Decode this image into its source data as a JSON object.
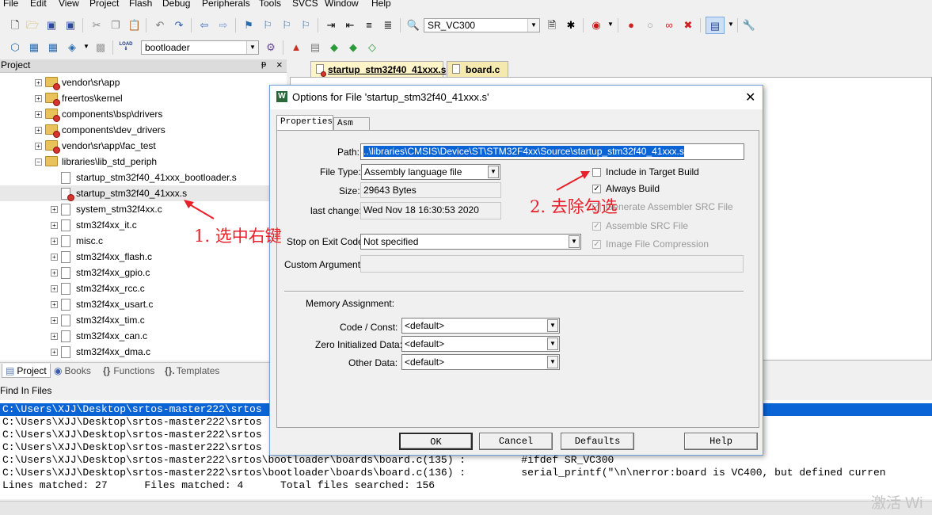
{
  "menu": [
    "File",
    "Edit",
    "View",
    "Project",
    "Flash",
    "Debug",
    "Peripherals",
    "Tools",
    "SVCS",
    "Window",
    "Help"
  ],
  "toolbar1": {
    "target_combo": "SR_VC300"
  },
  "toolbar2": {
    "target_name": "bootloader",
    "load_label": "LOAD"
  },
  "project_panel": {
    "title": "Project",
    "pin": "ᵽ",
    "close": "×",
    "tree": [
      {
        "label": "vendor\\sr\\app",
        "type": "group",
        "expand": "+"
      },
      {
        "label": "freertos\\kernel",
        "type": "group",
        "expand": "+"
      },
      {
        "label": "components\\bsp\\drivers",
        "type": "group",
        "expand": "+"
      },
      {
        "label": "components\\dev_drivers",
        "type": "group",
        "expand": "+"
      },
      {
        "label": "vendor\\sr\\app\\fac_test",
        "type": "group",
        "expand": "+"
      },
      {
        "label": "libraries\\lib_std_periph",
        "type": "open-folder",
        "expand": "−"
      },
      {
        "label": "startup_stm32f40_41xxx_bootloader.s",
        "type": "file",
        "expand": ""
      },
      {
        "label": "startup_stm32f40_41xxx.s",
        "type": "file-selected",
        "expand": ""
      },
      {
        "label": "system_stm32f4xx.c",
        "type": "file",
        "expand": "+"
      },
      {
        "label": "stm32f4xx_it.c",
        "type": "file",
        "expand": "+"
      },
      {
        "label": "misc.c",
        "type": "file",
        "expand": "+"
      },
      {
        "label": "stm32f4xx_flash.c",
        "type": "file",
        "expand": "+"
      },
      {
        "label": "stm32f4xx_gpio.c",
        "type": "file",
        "expand": "+"
      },
      {
        "label": "stm32f4xx_rcc.c",
        "type": "file",
        "expand": "+"
      },
      {
        "label": "stm32f4xx_usart.c",
        "type": "file",
        "expand": "+"
      },
      {
        "label": "stm32f4xx_tim.c",
        "type": "file",
        "expand": "+"
      },
      {
        "label": "stm32f4xx_can.c",
        "type": "file",
        "expand": "+"
      },
      {
        "label": "stm32f4xx_dma.c",
        "type": "file",
        "expand": "+"
      }
    ],
    "tabs": [
      "Project",
      "Books",
      "Functions",
      "Templates"
    ]
  },
  "editor": {
    "tabs": [
      "startup_stm32f40_41xxx.s",
      "board.c"
    ]
  },
  "find_in_files": {
    "title": "Find In Files",
    "lines": [
      "C:\\Users\\XJJ\\Desktop\\srtos-master222\\srtos",
      "C:\\Users\\XJJ\\Desktop\\srtos-master222\\srtos",
      "C:\\Users\\XJJ\\Desktop\\srtos-master222\\srtos",
      "C:\\Users\\XJJ\\Desktop\\srtos-master222\\srtos",
      "C:\\Users\\XJJ\\Desktop\\srtos-master222\\srtos\\bootloader\\boards\\board.c(135) :         #ifdef SR_VC300",
      "C:\\Users\\XJJ\\Desktop\\srtos-master222\\srtos\\bootloader\\boards\\board.c(136) :         serial_printf(\"\\n\\nerror:board is VC400, but defined curren",
      "Lines matched: 27      Files matched: 4      Total files searched: 156"
    ]
  },
  "dialog": {
    "title": "Options for File 'startup_stm32f40_41xxx.s'",
    "close": "✕",
    "tabs": [
      "Properties",
      "Asm"
    ],
    "path_label": "Path:",
    "path_value": "..\\libraries\\CMSIS\\Device\\ST\\STM32F4xx\\Source\\startup_stm32f40_41xxx.s",
    "file_type_label": "File Type:",
    "file_type_value": "Assembly language file",
    "size_label": "Size:",
    "size_value": "29643 Bytes",
    "last_change_label": "last change:",
    "last_change_value": "Wed Nov 18 16:30:53 2020",
    "stop_label": "Stop on Exit Code:",
    "stop_value": "Not specified",
    "custom_args_label": "Custom Arguments:",
    "custom_args_value": "",
    "checks": [
      {
        "label": "Include in Target Build",
        "checked": "",
        "disabled": false
      },
      {
        "label": "Always Build",
        "checked": "✓",
        "disabled": false
      },
      {
        "label": "Generate Assembler SRC File",
        "checked": "✓",
        "disabled": true
      },
      {
        "label": "Assemble SRC File",
        "checked": "✓",
        "disabled": true
      },
      {
        "label": "Image File Compression",
        "checked": "✓",
        "disabled": true
      }
    ],
    "memory_label": "Memory Assignment:",
    "memory": [
      {
        "label": "Code / Const:",
        "value": "<default>"
      },
      {
        "label": "Zero Initialized Data:",
        "value": "<default>"
      },
      {
        "label": "Other Data:",
        "value": "<default>"
      }
    ],
    "buttons": [
      "OK",
      "Cancel",
      "Defaults",
      "Help"
    ]
  },
  "annotations": {
    "step1": "1. 选中右键",
    "step2": "2. 去除勾选",
    "color": "#e8202a"
  },
  "watermark": "激活 Wi"
}
